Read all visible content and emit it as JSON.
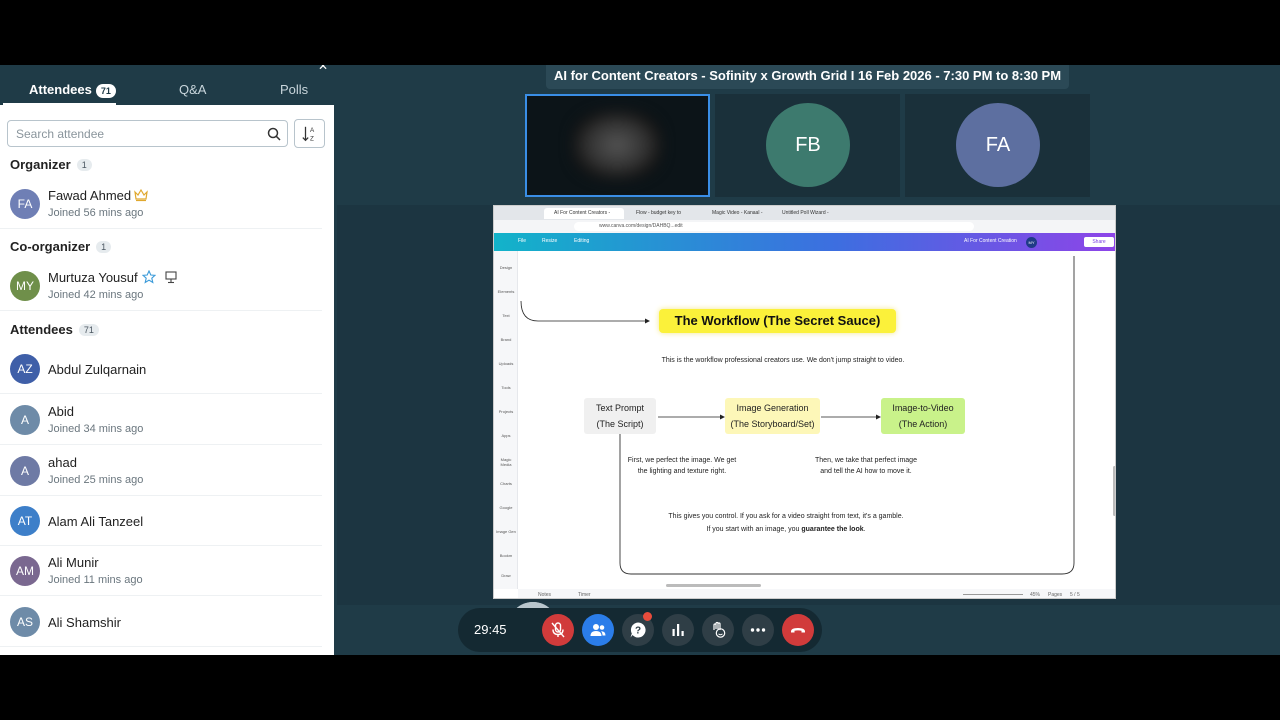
{
  "sidebar": {
    "tabs": [
      {
        "label": "Attendees",
        "count": "71"
      },
      {
        "label": "Q&A"
      },
      {
        "label": "Polls"
      }
    ],
    "search_placeholder": "Search attendee",
    "sections": {
      "organizer": {
        "label": "Organizer",
        "count": "1"
      },
      "co_organizer": {
        "label": "Co-organizer",
        "count": "1"
      },
      "attendees": {
        "label": "Attendees",
        "count": "71"
      }
    },
    "people": [
      {
        "initials": "FA",
        "name": "Fawad Ahmed",
        "joined": "Joined 56 mins ago",
        "color": "#6f7fb5"
      },
      {
        "initials": "MY",
        "name": "Murtuza Yousuf",
        "joined": "Joined 42 mins ago",
        "color": "#6f8f4a"
      },
      {
        "initials": "AZ",
        "name": "Abdul Zulqarnain",
        "joined": "",
        "color": "#3f5fa8"
      },
      {
        "initials": "A",
        "name": "Abid",
        "joined": "Joined 34 mins ago",
        "color": "#6e8ba8"
      },
      {
        "initials": "A",
        "name": "ahad",
        "joined": "Joined 25 mins ago",
        "color": "#6e7aa5"
      },
      {
        "initials": "AT",
        "name": "Alam Ali Tanzeel",
        "joined": "",
        "color": "#3d7fc9"
      },
      {
        "initials": "AM",
        "name": "Ali Munir",
        "joined": "Joined 11 mins ago",
        "color": "#7a6890"
      },
      {
        "initials": "AS",
        "name": "Ali Shamshir",
        "joined": "",
        "color": "#6e8ba8"
      }
    ]
  },
  "meeting": {
    "title": "AI for Content Creators - Sofinity x Growth Grid I 16 Feb 2026 - 7:30 PM to 8:30 PM",
    "tiles": [
      {
        "initials": "FB",
        "color": "#3d7a6e"
      },
      {
        "initials": "FA",
        "color": "#5d6fa0"
      }
    ],
    "timer": "29:45"
  },
  "slide": {
    "title": "The Workflow (The Secret Sauce)",
    "subtitle": "This is the workflow professional creators use. We don't jump straight to video.",
    "box1_line1": "Text Prompt",
    "box1_line2": "(The Script)",
    "box2_line1": "Image Generation",
    "box2_line2": "(The Storyboard/Set)",
    "box3_line1": "Image-to-Video",
    "box3_line2": "(The Action)",
    "note1_line1": "First, we perfect the image. We get",
    "note1_line2": "the lighting and texture right.",
    "note2_line1": "Then, we take that perfect image",
    "note2_line2": "and tell the AI how to move it.",
    "bottom_line1": "This gives you control. If you ask for a video straight from text, it's a gamble.",
    "bottom_line2_pre": "If you start with an image, you ",
    "bottom_line2_bold": "guarantee the look",
    "bottom_line2_post": "."
  },
  "browser": {
    "tabs": [
      "AI For Content Creators - White",
      "Flow - budget key to video",
      "Magic Video - Kanaal - Canva",
      "Untitled Poll Wizard - Canva"
    ],
    "url": "www.canva.com/design/DAHBQ...edit",
    "canva_file": "File",
    "canva_resize": "Resize",
    "canva_editing": "Editing",
    "canva_doc_title": "AI For Content Creation",
    "canva_user": "MY",
    "canva_share": "Share",
    "side_items": [
      "Design",
      "Elements",
      "Text",
      "Brand",
      "Uploads",
      "Tools",
      "Projects",
      "Apps",
      "Magic Media",
      "Charts",
      "Google",
      "Image Gen",
      "Bookm",
      "Draw"
    ],
    "footer_notes": "Notes",
    "footer_timer": "Timer",
    "footer_zoom": "45%",
    "footer_pages": "Pages",
    "footer_page_count": "5 / 5"
  },
  "colors": {
    "bg": "#1f3b47",
    "accent": "#3a8ee6",
    "end_call": "#d13b3b",
    "highlight": "#fbf13a",
    "flow_yellow": "#fdf7b8",
    "flow_green": "#c9f28a"
  }
}
